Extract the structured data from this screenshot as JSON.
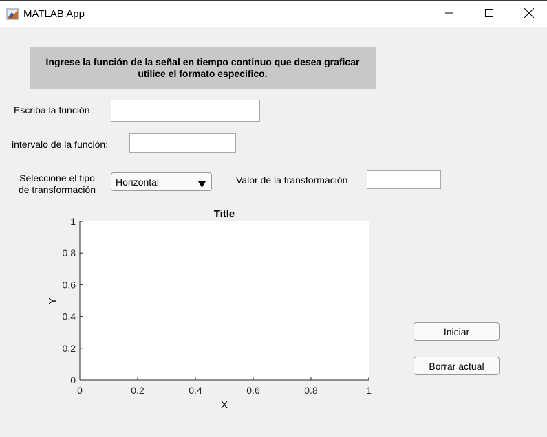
{
  "window": {
    "title": "MATLAB App"
  },
  "banner": {
    "line1": "Ingrese la función de la señal en tiempo continuo que desea graficar",
    "line2": "utilice el formato especifico."
  },
  "form": {
    "function_label": "Escriba la función :",
    "function_value": "",
    "interval_label": "intervalo de la función:",
    "interval_value": "",
    "transform_type_label_line1": "Seleccione el tipo",
    "transform_type_label_line2": "de transformación",
    "transform_type_selected": "Horizontal",
    "transform_value_label": "Valor de la transformación",
    "transform_value": ""
  },
  "buttons": {
    "start": "Iniciar",
    "clear": "Borrar actual"
  },
  "icons": {
    "app": "matlab-logo-icon",
    "minimize": "minimize-icon",
    "maximize": "maximize-icon",
    "close": "close-icon",
    "dropdown": "triangle-down-icon"
  },
  "chart_data": {
    "type": "line",
    "title": "Title",
    "xlabel": "X",
    "ylabel": "Y",
    "xlim": [
      0,
      1
    ],
    "ylim": [
      0,
      1
    ],
    "xticks": [
      "0",
      "0.2",
      "0.4",
      "0.6",
      "0.8",
      "1"
    ],
    "yticks": [
      "0",
      "0.2",
      "0.4",
      "0.6",
      "0.8",
      "1"
    ],
    "series": [],
    "grid": false
  }
}
